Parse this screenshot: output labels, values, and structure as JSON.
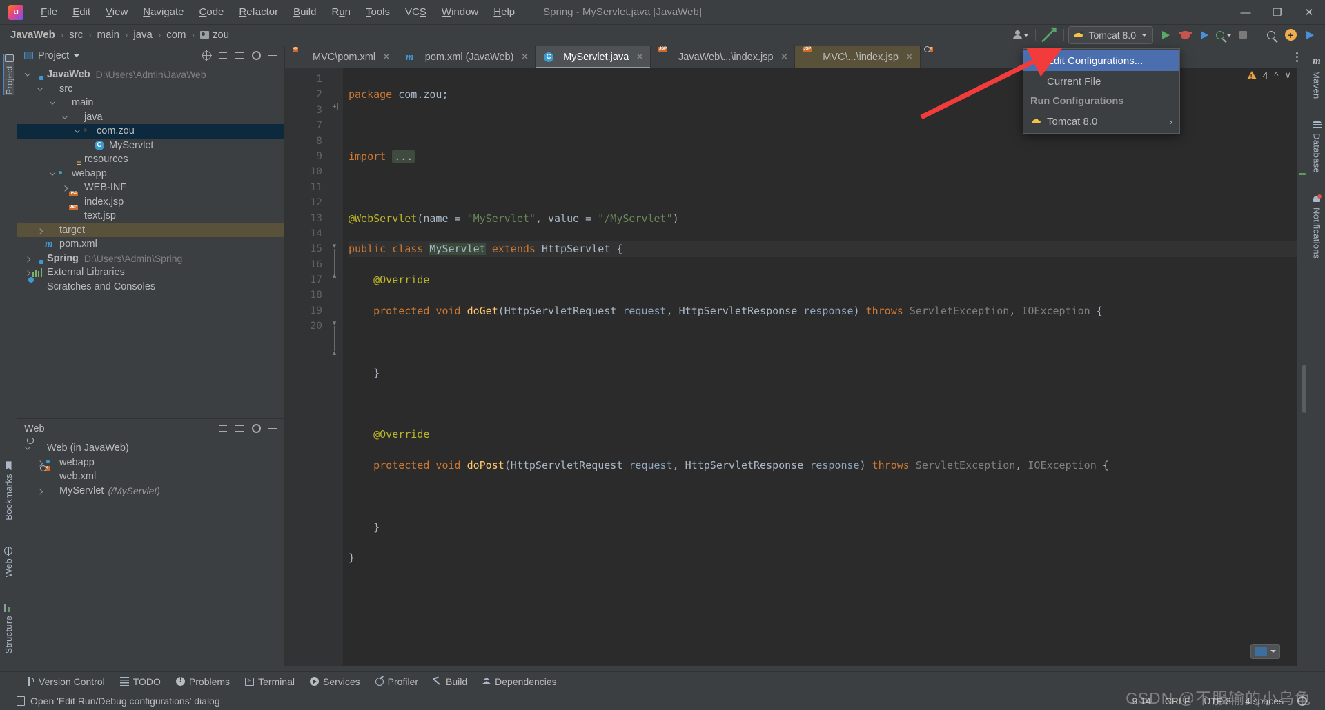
{
  "window": {
    "title": "Spring - MyServlet.java [JavaWeb]",
    "minimize": "—",
    "maximize": "❐",
    "close": "✕"
  },
  "menubar": {
    "items": [
      {
        "label": "File",
        "accel": "F"
      },
      {
        "label": "Edit",
        "accel": "E"
      },
      {
        "label": "View",
        "accel": "V"
      },
      {
        "label": "Navigate",
        "accel": "N"
      },
      {
        "label": "Code",
        "accel": "C"
      },
      {
        "label": "Refactor",
        "accel": "R"
      },
      {
        "label": "Build",
        "accel": "B"
      },
      {
        "label": "Run",
        "accel": "u"
      },
      {
        "label": "Tools",
        "accel": "T"
      },
      {
        "label": "VCS",
        "accel": "S"
      },
      {
        "label": "Window",
        "accel": "W"
      },
      {
        "label": "Help",
        "accel": "H"
      }
    ]
  },
  "breadcrumb": {
    "items": [
      "JavaWeb",
      "src",
      "main",
      "java",
      "com",
      "zou"
    ],
    "separator": "›"
  },
  "toolbar": {
    "run_config_label": "Tomcat 8.0",
    "run_tooltip": "Run",
    "debug_tooltip": "Debug",
    "coverage_tooltip": "Run with Coverage",
    "stop_tooltip": "Stop",
    "search_tooltip": "Search Everywhere",
    "updates_tooltip": "Updates",
    "share_tooltip": "Share"
  },
  "dropdown": {
    "edit_configurations": "Edit Configurations...",
    "current_file": "Current File",
    "section_header": "Run Configurations",
    "tomcat_item": "Tomcat 8.0",
    "submenu_arrow": "›",
    "highlight_color": "#4b6eaf"
  },
  "left_strip": {
    "project": "Project",
    "bookmarks": "Bookmarks",
    "web": "Web",
    "structure": "Structure"
  },
  "right_strip": {
    "maven": "Maven",
    "database": "Database",
    "notifications": "Notifications"
  },
  "project_panel": {
    "title": "Project",
    "tree": [
      {
        "label": "JavaWeb",
        "path": "D:\\Users\\Admin\\JavaWeb",
        "indent": 0,
        "twisty": "down",
        "icon": "folder-module",
        "bold": true,
        "selected": false
      },
      {
        "label": "src",
        "path": "",
        "indent": 1,
        "twisty": "down",
        "icon": "folder-plain",
        "bold": false,
        "selected": false
      },
      {
        "label": "main",
        "path": "",
        "indent": 2,
        "twisty": "down",
        "icon": "folder-plain",
        "bold": false,
        "selected": false
      },
      {
        "label": "java",
        "path": "",
        "indent": 3,
        "twisty": "down",
        "icon": "folder-blue",
        "bold": false,
        "selected": false
      },
      {
        "label": "com.zou",
        "path": "",
        "indent": 4,
        "twisty": "down",
        "icon": "folder-package",
        "bold": false,
        "selected": true
      },
      {
        "label": "MyServlet",
        "path": "",
        "indent": 5,
        "twisty": "none",
        "icon": "class",
        "bold": false,
        "selected": false
      },
      {
        "label": "resources",
        "path": "",
        "indent": 3,
        "twisty": "none",
        "icon": "folder-resources",
        "bold": false,
        "selected": false
      },
      {
        "label": "webapp",
        "path": "",
        "indent": 2,
        "twisty": "down",
        "icon": "folder-webroot",
        "bold": false,
        "selected": false
      },
      {
        "label": "WEB-INF",
        "path": "",
        "indent": 3,
        "twisty": "right",
        "icon": "folder-plain",
        "bold": false,
        "selected": false
      },
      {
        "label": "index.jsp",
        "path": "",
        "indent": 3,
        "twisty": "none",
        "icon": "jsp",
        "bold": false,
        "selected": false
      },
      {
        "label": "text.jsp",
        "path": "",
        "indent": 3,
        "twisty": "none",
        "icon": "jsp",
        "bold": false,
        "selected": false
      },
      {
        "label": "target",
        "path": "",
        "indent": 1,
        "twisty": "right",
        "icon": "folder-orange",
        "bold": false,
        "selected": false,
        "highlight": true
      },
      {
        "label": "pom.xml",
        "path": "",
        "indent": 1,
        "twisty": "none",
        "icon": "maven",
        "bold": false,
        "selected": false
      },
      {
        "label": "Spring",
        "path": "D:\\Users\\Admin\\Spring",
        "indent": 0,
        "twisty": "right",
        "icon": "folder-module",
        "bold": true,
        "selected": false
      },
      {
        "label": "External Libraries",
        "path": "",
        "indent": 0,
        "twisty": "right",
        "icon": "libraries",
        "bold": false,
        "selected": false
      },
      {
        "label": "Scratches and Consoles",
        "path": "",
        "indent": 0,
        "twisty": "none",
        "icon": "scratches",
        "bold": false,
        "selected": false
      }
    ]
  },
  "web_panel": {
    "title": "Web",
    "tree": [
      {
        "label": "Web (in JavaWeb)",
        "sub": "",
        "indent": 0,
        "twisty": "down",
        "icon": "web-module"
      },
      {
        "label": "webapp",
        "sub": "",
        "indent": 1,
        "twisty": "right",
        "icon": "folder-webroot"
      },
      {
        "label": "web.xml",
        "sub": "",
        "indent": 1,
        "twisty": "none",
        "icon": "webxml"
      },
      {
        "label": "MyServlet",
        "sub": "(/MyServlet)",
        "indent": 1,
        "twisty": "right",
        "icon": "servlet"
      }
    ]
  },
  "editor": {
    "tabs": [
      {
        "label": "MVC\\pom.xml",
        "icon": "xml",
        "active": false,
        "modified": false,
        "closable": true
      },
      {
        "label": "pom.xml (JavaWeb)",
        "icon": "maven",
        "active": false,
        "modified": false,
        "closable": true
      },
      {
        "label": "MyServlet.java",
        "icon": "class",
        "active": true,
        "modified": false,
        "closable": true
      },
      {
        "label": "JavaWeb\\...\\index.jsp",
        "icon": "jsp",
        "active": false,
        "modified": false,
        "closable": true
      },
      {
        "label": "MVC\\...\\index.jsp",
        "icon": "jsp",
        "active": false,
        "modified": true,
        "closable": true
      },
      {
        "label": "",
        "icon": "webxml",
        "active": false,
        "modified": false,
        "closable": false
      }
    ],
    "warning_count": "4",
    "line_numbers": [
      "1",
      "2",
      "3",
      "7",
      "8",
      "9",
      "10",
      "11",
      "12",
      "13",
      "14",
      "15",
      "16",
      "17",
      "18",
      "19",
      "20"
    ],
    "code_lines": [
      "package com.zou;",
      "",
      "import ...",
      "",
      "@WebServlet(name = \"MyServlet\", value = \"/MyServlet\")",
      "public class MyServlet extends HttpServlet {",
      "    @Override",
      "    protected void doGet(HttpServletRequest request, HttpServletResponse response) throws ServletException, IOException {",
      "",
      "    }",
      "",
      "    @Override",
      "    protected void doPost(HttpServletRequest request, HttpServletResponse response) throws ServletException, IOException {",
      "",
      "    }",
      "}",
      ""
    ]
  },
  "bottom_tools": [
    {
      "label": "Version Control",
      "icon": "vcs-icon"
    },
    {
      "label": "TODO",
      "icon": "todo-icon"
    },
    {
      "label": "Problems",
      "icon": "problems-icon"
    },
    {
      "label": "Terminal",
      "icon": "terminal-icon"
    },
    {
      "label": "Services",
      "icon": "services-icon"
    },
    {
      "label": "Profiler",
      "icon": "profiler-icon"
    },
    {
      "label": "Build",
      "icon": "build-icon"
    },
    {
      "label": "Dependencies",
      "icon": "dependencies-icon"
    }
  ],
  "statusbar": {
    "message": "Open 'Edit Run/Debug configurations' dialog",
    "caret_position": "9:14",
    "line_separator": "CRLF",
    "encoding": "UTF-8",
    "indent": "4 spaces"
  },
  "watermark": {
    "text": "CSDN @不服输的小乌龟"
  }
}
